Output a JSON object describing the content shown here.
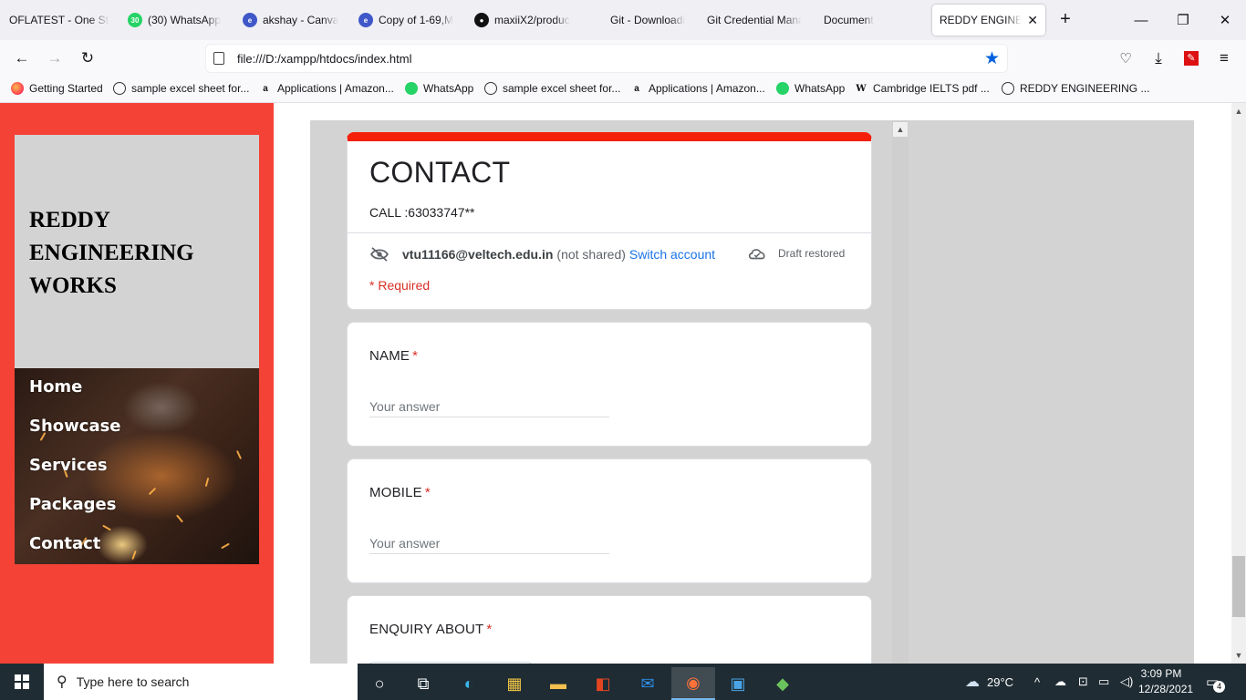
{
  "browser": {
    "tabs": [
      {
        "label": "OFLATEST - One Sto",
        "icon": "none",
        "color": ""
      },
      {
        "label": "(30) WhatsApp",
        "icon": "whatsapp-icon",
        "badge": "30",
        "color": "#25d366"
      },
      {
        "label": "akshay - Canva",
        "icon": "edge-icon",
        "color": "#0c59a4"
      },
      {
        "label": "Copy of 1-69,M",
        "icon": "edge-icon",
        "color": "#0c59a4"
      },
      {
        "label": "maxiiX2/produc",
        "icon": "github-icon",
        "color": "#111111"
      },
      {
        "label": "Git - Downloadi",
        "icon": "none",
        "color": ""
      },
      {
        "label": "Git Credential Mana",
        "icon": "none",
        "color": ""
      },
      {
        "label": "Document",
        "icon": "none",
        "color": ""
      },
      {
        "label": "REDDY ENGINEERI",
        "icon": "none",
        "color": "",
        "active": true
      }
    ],
    "new_tab": "+",
    "url": "file:///D:/xampp/htdocs/index.html",
    "bookmarks": [
      {
        "label": "Getting Started",
        "icon": "firefox-icon"
      },
      {
        "label": "sample excel sheet for...",
        "icon": "globe-icon"
      },
      {
        "label": "Applications | Amazon...",
        "icon": "amazon-icon"
      },
      {
        "label": "WhatsApp",
        "icon": "whatsapp-icon"
      },
      {
        "label": "sample excel sheet for...",
        "icon": "globe-icon"
      },
      {
        "label": "Applications | Amazon...",
        "icon": "amazon-icon"
      },
      {
        "label": "WhatsApp",
        "icon": "whatsapp-icon"
      },
      {
        "label": "Cambridge IELTS pdf ...",
        "icon": "cambridge-icon"
      },
      {
        "label": "REDDY ENGINEERING ...",
        "icon": "globe-icon"
      }
    ]
  },
  "site": {
    "brand": "REDDY ENGINEERING WORKS",
    "accent_color": "#f44336",
    "menu": [
      "Home",
      "Showcase",
      "Services",
      "Packages",
      "Contact"
    ]
  },
  "form": {
    "title": "CONTACT",
    "description": "CALL :63033747**",
    "email": "vtu11166@veltech.edu.in",
    "not_shared": "(not shared)",
    "switch_account": "Switch account",
    "draft_status": "Draft restored",
    "required_note": "* Required",
    "header_color": "#f4200a",
    "questions": [
      {
        "label": "NAME",
        "placeholder": "Your answer",
        "type": "text"
      },
      {
        "label": "MOBILE",
        "placeholder": "Your answer",
        "type": "text"
      },
      {
        "label": "ENQUIRY ABOUT",
        "placeholder": "",
        "type": "dropdown"
      }
    ],
    "required_mark": "*"
  },
  "taskbar": {
    "search_placeholder": "Type here to search",
    "weather": "29°C",
    "time": "3:09 PM",
    "date": "12/28/2021",
    "notifications": "4"
  }
}
